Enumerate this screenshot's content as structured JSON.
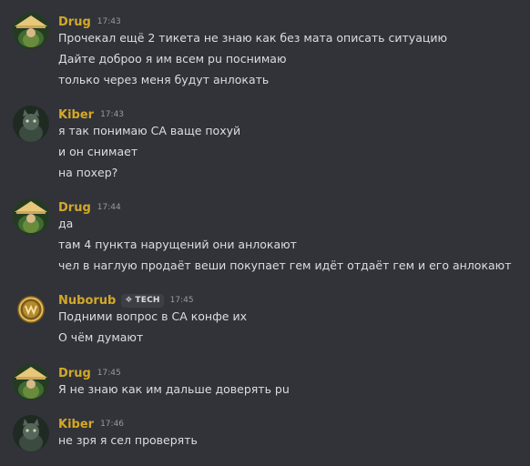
{
  "colors": {
    "background": "#313338",
    "text": "#dbdee1",
    "timestamp": "#949ba4",
    "username_gold": "#d4a829"
  },
  "messages": [
    {
      "username": "Drug",
      "time": "17:43",
      "avatar_icon": "straw-hat-avatar",
      "lines": [
        "Прочекал ещё 2 тикета  не знаю как без мата описать ситуацию",
        "Дайте доброо я им всем pu поснимаю",
        "только через меня будут анлокать"
      ]
    },
    {
      "username": "Kiber",
      "time": "17:43",
      "avatar_icon": "cat-avatar",
      "lines": [
        "я так понимаю СА ваще похуй",
        "и он снимает",
        "на похер?"
      ]
    },
    {
      "username": "Drug",
      "time": "17:44",
      "avatar_icon": "straw-hat-avatar",
      "lines": [
        "да",
        "там 4 пункта нарущений они анлокают",
        "чел в наглую продаёт веши покупает гем идёт отдаёт гем и его анлокают"
      ]
    },
    {
      "username": "Nuborub",
      "time": "17:45",
      "avatar_icon": "gold-emblem-avatar",
      "tag": "TECH",
      "lines": [
        "Подними вопрос в СА конфе их",
        "О чём думают"
      ]
    },
    {
      "username": "Drug",
      "time": "17:45",
      "avatar_icon": "straw-hat-avatar",
      "lines": [
        "Я не знаю как им дальше доверять pu"
      ]
    },
    {
      "username": "Kiber",
      "time": "17:46",
      "avatar_icon": "cat-avatar",
      "lines": [
        "не зря я сел проверять"
      ]
    }
  ]
}
